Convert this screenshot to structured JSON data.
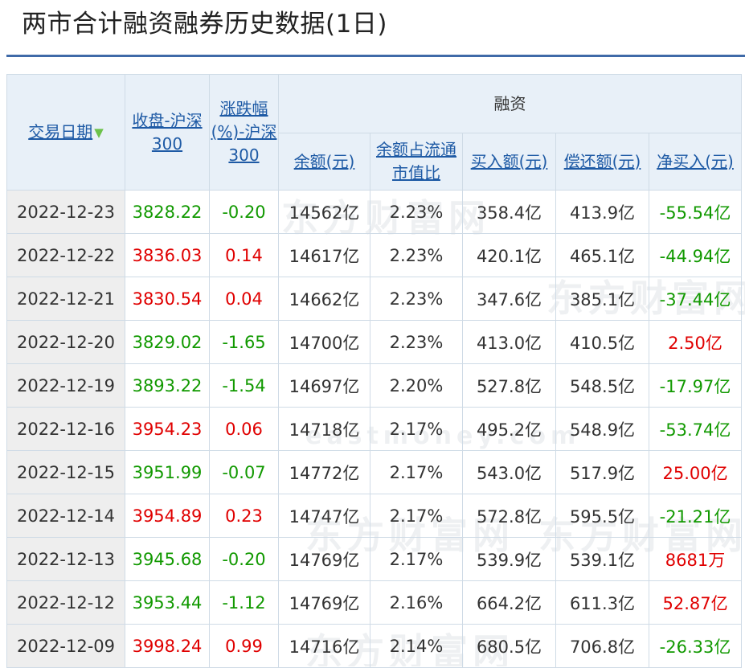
{
  "page": {
    "title": "两市合计融资融券历史数据(1日)"
  },
  "watermark": {
    "brand": "东方财富网",
    "domain": "eastmoney.com"
  },
  "colors": {
    "up": "#e00000",
    "down": "#119900",
    "link": "#1e5aa5",
    "rule": "#3f6aa8"
  },
  "table": {
    "headers": {
      "date": "交易日期",
      "close": "收盘-沪深300",
      "change": "涨跌幅(%)-沪深300",
      "group": "融资",
      "balance": "余额(元)",
      "ratio": "余额占流通市值比",
      "buy": "买入额(元)",
      "repay": "偿还额(元)",
      "net": "净买入(元)"
    },
    "sort_icon": "sort-down-arrow-icon",
    "rows": [
      {
        "date": "2022-12-23",
        "close": "3828.22",
        "close_dir": "down",
        "change": "-0.20",
        "change_dir": "down",
        "balance": "14562亿",
        "ratio": "2.23%",
        "buy": "358.4亿",
        "repay": "413.9亿",
        "net": "-55.54亿",
        "net_dir": "down"
      },
      {
        "date": "2022-12-22",
        "close": "3836.03",
        "close_dir": "up",
        "change": "0.14",
        "change_dir": "up",
        "balance": "14617亿",
        "ratio": "2.23%",
        "buy": "420.1亿",
        "repay": "465.1亿",
        "net": "-44.94亿",
        "net_dir": "down"
      },
      {
        "date": "2022-12-21",
        "close": "3830.54",
        "close_dir": "up",
        "change": "0.04",
        "change_dir": "up",
        "balance": "14662亿",
        "ratio": "2.23%",
        "buy": "347.6亿",
        "repay": "385.1亿",
        "net": "-37.44亿",
        "net_dir": "down"
      },
      {
        "date": "2022-12-20",
        "close": "3829.02",
        "close_dir": "down",
        "change": "-1.65",
        "change_dir": "down",
        "balance": "14700亿",
        "ratio": "2.23%",
        "buy": "413.0亿",
        "repay": "410.5亿",
        "net": "2.50亿",
        "net_dir": "up"
      },
      {
        "date": "2022-12-19",
        "close": "3893.22",
        "close_dir": "down",
        "change": "-1.54",
        "change_dir": "down",
        "balance": "14697亿",
        "ratio": "2.20%",
        "buy": "527.8亿",
        "repay": "548.5亿",
        "net": "-17.97亿",
        "net_dir": "down"
      },
      {
        "date": "2022-12-16",
        "close": "3954.23",
        "close_dir": "up",
        "change": "0.06",
        "change_dir": "up",
        "balance": "14718亿",
        "ratio": "2.17%",
        "buy": "495.2亿",
        "repay": "548.9亿",
        "net": "-53.74亿",
        "net_dir": "down"
      },
      {
        "date": "2022-12-15",
        "close": "3951.99",
        "close_dir": "down",
        "change": "-0.07",
        "change_dir": "down",
        "balance": "14772亿",
        "ratio": "2.17%",
        "buy": "543.0亿",
        "repay": "517.9亿",
        "net": "25.00亿",
        "net_dir": "up"
      },
      {
        "date": "2022-12-14",
        "close": "3954.89",
        "close_dir": "up",
        "change": "0.23",
        "change_dir": "up",
        "balance": "14747亿",
        "ratio": "2.17%",
        "buy": "572.8亿",
        "repay": "595.5亿",
        "net": "-21.21亿",
        "net_dir": "down"
      },
      {
        "date": "2022-12-13",
        "close": "3945.68",
        "close_dir": "down",
        "change": "-0.20",
        "change_dir": "down",
        "balance": "14769亿",
        "ratio": "2.17%",
        "buy": "539.9亿",
        "repay": "539.1亿",
        "net": "8681万",
        "net_dir": "up"
      },
      {
        "date": "2022-12-12",
        "close": "3953.44",
        "close_dir": "down",
        "change": "-1.12",
        "change_dir": "down",
        "balance": "14769亿",
        "ratio": "2.16%",
        "buy": "664.2亿",
        "repay": "611.3亿",
        "net": "52.87亿",
        "net_dir": "up"
      },
      {
        "date": "2022-12-09",
        "close": "3998.24",
        "close_dir": "up",
        "change": "0.99",
        "change_dir": "up",
        "balance": "14716亿",
        "ratio": "2.14%",
        "buy": "680.5亿",
        "repay": "706.8亿",
        "net": "-26.33亿",
        "net_dir": "down"
      }
    ]
  }
}
